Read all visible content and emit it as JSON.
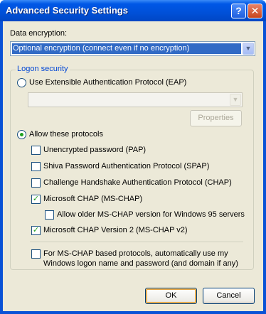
{
  "window": {
    "title": "Advanced Security Settings",
    "help_glyph": "?",
    "close_glyph": "✕"
  },
  "encryption": {
    "label": "Data encryption:",
    "selected": "Optional encryption (connect even if no encryption)",
    "arrow": "▼"
  },
  "logon": {
    "group_label": "Logon security",
    "eap_label": "Use Extensible Authentication Protocol (EAP)",
    "eap_selected": false,
    "eap_dropdown_value": "",
    "properties_label": "Properties",
    "allow_label": "Allow these protocols",
    "allow_selected": true,
    "protocols": [
      {
        "label": "Unencrypted password (PAP)",
        "checked": false
      },
      {
        "label": "Shiva Password Authentication Protocol (SPAP)",
        "checked": false
      },
      {
        "label": "Challenge Handshake Authentication Protocol (CHAP)",
        "checked": false
      },
      {
        "label": "Microsoft CHAP (MS-CHAP)",
        "checked": true
      },
      {
        "label": "Allow older MS-CHAP version for Windows 95 servers",
        "checked": false
      },
      {
        "label": "Microsoft CHAP Version 2 (MS-CHAP v2)",
        "checked": true
      }
    ],
    "auto_logon_label_1": "For MS-CHAP based protocols, automatically use my",
    "auto_logon_label_2": "Windows logon name and password (and domain if any)",
    "auto_logon_checked": false
  },
  "buttons": {
    "ok": "OK",
    "cancel": "Cancel"
  },
  "check_glyph": "✓"
}
